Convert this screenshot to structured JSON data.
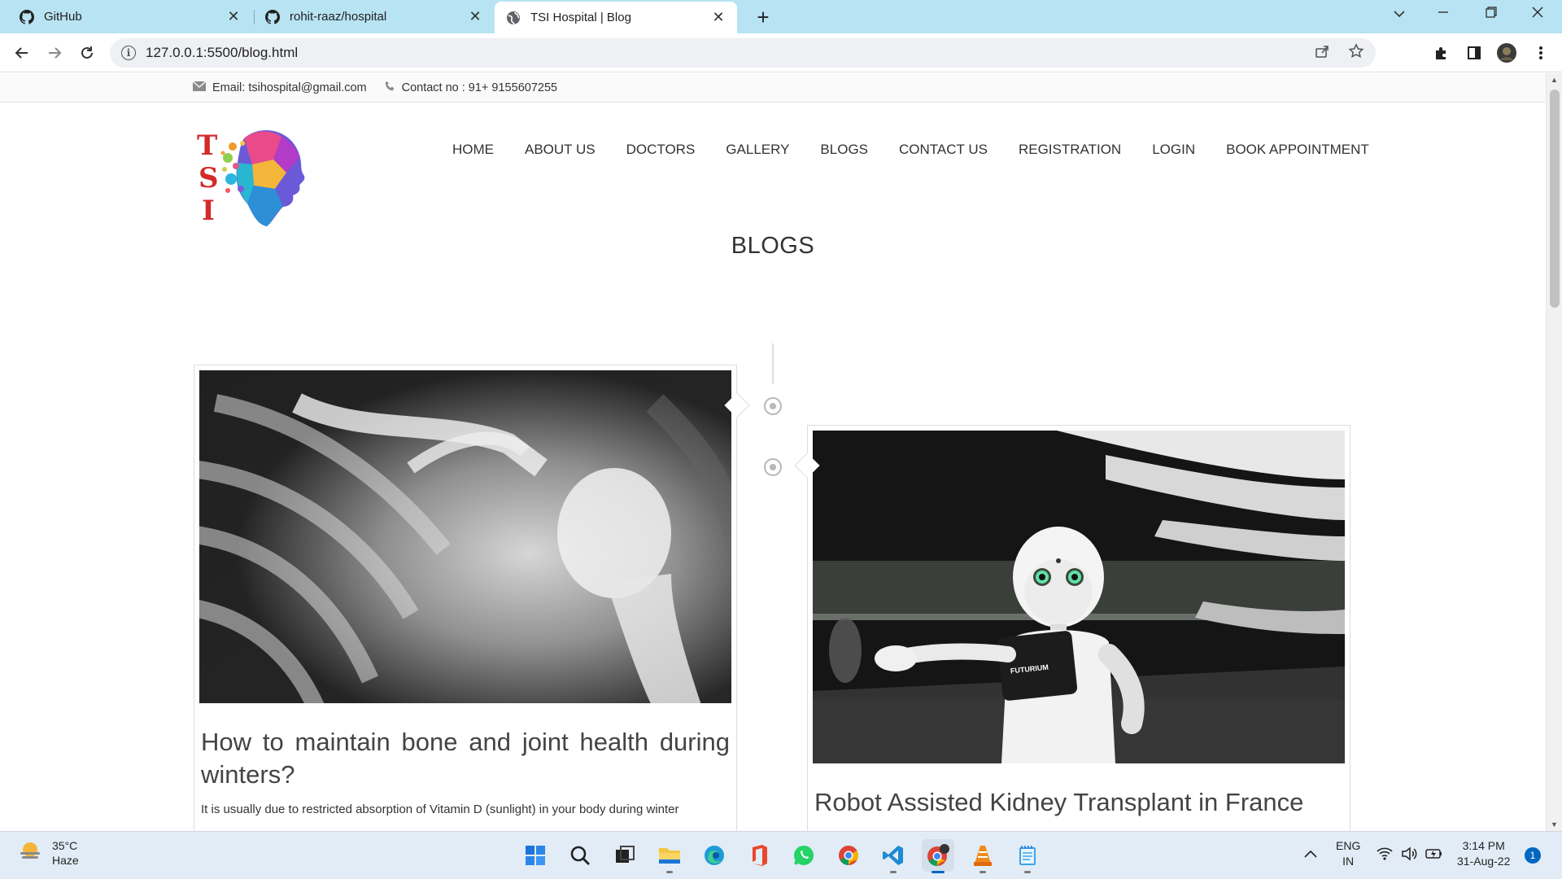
{
  "browser": {
    "tabs": [
      {
        "label": "GitHub",
        "icon": "github-icon",
        "active": false
      },
      {
        "label": "rohit-raaz/hospital",
        "icon": "github-icon",
        "active": false
      },
      {
        "label": "TSI Hospital | Blog",
        "icon": "globe-icon",
        "active": true
      }
    ],
    "new_tab": "+",
    "url": "127.0.0.1:5500/blog.html"
  },
  "site": {
    "topbar": {
      "email": "Email: tsihospital@gmail.com",
      "contact": "Contact no : 91+ 9155607255"
    },
    "logo_letters": [
      "T",
      "S",
      "I"
    ],
    "nav": [
      "HOME",
      "ABOUT US",
      "DOCTORS",
      "GALLERY",
      "BLOGS",
      "CONTACT US",
      "REGISTRATION",
      "LOGIN",
      "BOOK APPOINTMENT"
    ],
    "page_title": "BLOGS",
    "posts": [
      {
        "title": "How to maintain bone and joint health during winters?",
        "excerpt": "It is usually due to restricted absorption of Vitamin D (sunlight) in your body during winter",
        "image": "chest-xray-image"
      },
      {
        "title": "Robot Assisted Kidney Transplant in France",
        "excerpt": "",
        "image": "robot-image",
        "robot_label": "FUTURIUM"
      }
    ]
  },
  "taskbar": {
    "weather": {
      "temp": "35°C",
      "condition": "Haze"
    },
    "lang": {
      "line1": "ENG",
      "line2": "IN"
    },
    "clock": {
      "time": "3:14 PM",
      "date": "31-Aug-22"
    },
    "notifications": "1"
  },
  "colors": {
    "tabbar_bg": "#b8e3f2",
    "taskbar_bg": "#e2ecf6",
    "accent": "#0067c0",
    "logo_red": "#d42a2a"
  }
}
